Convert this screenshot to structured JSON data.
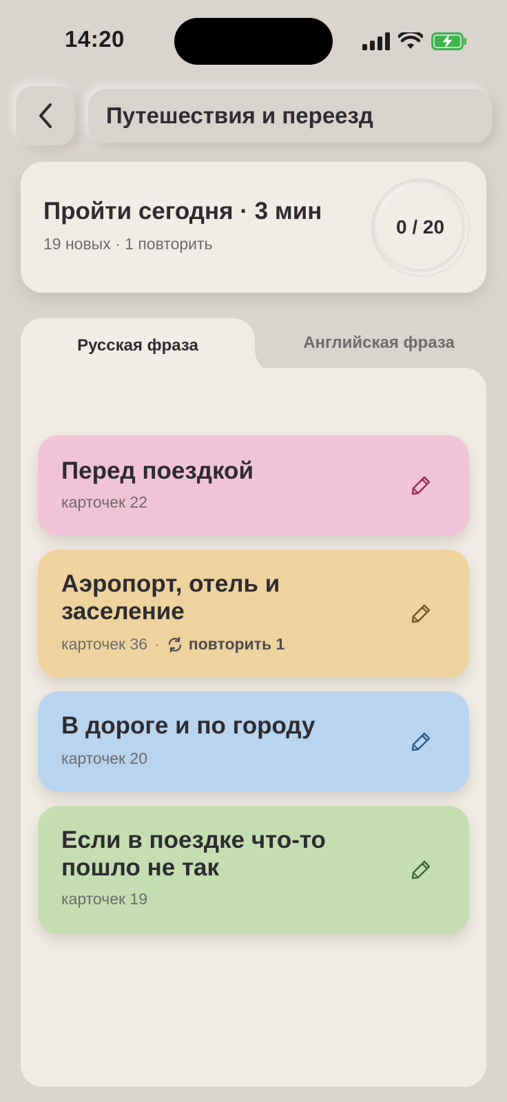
{
  "status": {
    "time": "14:20"
  },
  "header": {
    "title": "Путешествия и переезд"
  },
  "today": {
    "title": "Пройти сегодня · 3 мин",
    "subtitle": "19 новых · 1 повторить",
    "progress": "0 / 20"
  },
  "tabs": [
    {
      "label": "Русская фраза",
      "active": true
    },
    {
      "label": "Английская фраза",
      "active": false
    }
  ],
  "categories": [
    {
      "title": "Перед поездкой",
      "meta": "карточек 22",
      "color": "#f0c4d6",
      "pencil_color": "#9c2f5c"
    },
    {
      "title": "Аэропорт, отель и заселение",
      "meta": "карточек 36",
      "separator": "·",
      "repeat": "повторить 1",
      "color": "#eed39e",
      "pencil_color": "#7a5620"
    },
    {
      "title": "В дороге и по городу",
      "meta": "карточек 20",
      "color": "#b9d4ee",
      "pencil_color": "#2c5f93"
    },
    {
      "title": "Если в поездке что-то пошло не так",
      "meta": "карточек 19",
      "color": "#c4deb2",
      "pencil_color": "#3f6b33"
    }
  ]
}
